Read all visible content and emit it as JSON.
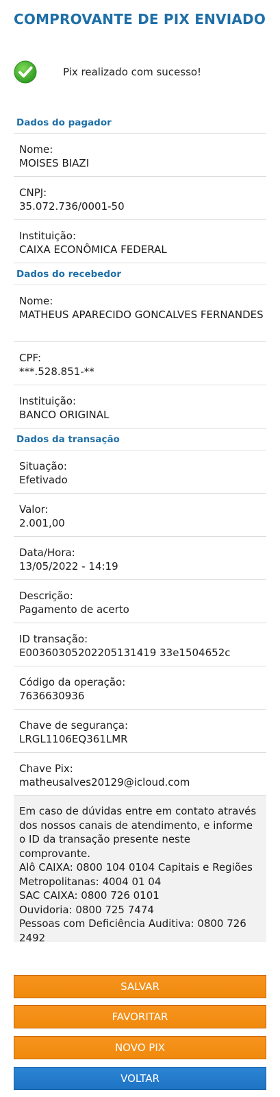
{
  "header": {
    "title": "COMPROVANTE DE PIX ENVIADO"
  },
  "status": {
    "icon": "check-circle-icon",
    "message": "Pix realizado com sucesso!",
    "icon_color": "#3aa52c"
  },
  "pagador": {
    "title": "Dados do pagador",
    "fields": [
      {
        "label": "Nome:",
        "value": "MOISES BIAZI"
      },
      {
        "label": "CNPJ:",
        "value": "35.072.736/0001-50"
      },
      {
        "label": "Instituição:",
        "value": "CAIXA ECONÔMICA FEDERAL"
      }
    ]
  },
  "recebedor": {
    "title": "Dados do recebedor",
    "fields": [
      {
        "label": "Nome:",
        "value": "MATHEUS APARECIDO GONCALVES FERNANDES"
      },
      {
        "label": "CPF:",
        "value": "***.528.851-**"
      },
      {
        "label": "Instituição:",
        "value": "BANCO ORIGINAL"
      }
    ]
  },
  "transacao": {
    "title": "Dados da transação",
    "fields": [
      {
        "label": "Situação:",
        "value": "Efetivado"
      },
      {
        "label": "Valor:",
        "value": "2.001,00"
      },
      {
        "label": "Data/Hora:",
        "value": "13/05/2022 - 14:19"
      },
      {
        "label": "Descrição:",
        "value": "Pagamento de acerto"
      },
      {
        "label": "ID transação:",
        "value": "E00360305202205131419 33e1504652c"
      },
      {
        "label": "Código da operação:",
        "value": "7636630936"
      },
      {
        "label": "Chave de segurança:",
        "value": "LRGL1106EQ361LMR"
      },
      {
        "label": "Chave Pix:",
        "value": "matheusalves20129@icloud.com"
      }
    ]
  },
  "info": {
    "text": "Em caso de dúvidas entre em contato através dos nossos canais de atendimento, e informe o ID da transação presente neste comprovante.",
    "lines": [
      "Alô CAIXA: 0800 104 0104 Capitais e Regiões Metropolitanas: 4004 01 04",
      "SAC CAIXA: 0800 726 0101",
      "Ouvidoria: 0800 725 7474",
      "Pessoas com Deficiência Auditiva: 0800 726 2492"
    ]
  },
  "buttons": {
    "salvar": "SALVAR",
    "favoritar": "FAVORITAR",
    "novo_pix": "NOVO PIX",
    "voltar": "VOLTAR"
  },
  "colors": {
    "title_blue": "#1e6fa8",
    "orange_button": "#f7931e",
    "blue_button": "#2b84d4"
  }
}
